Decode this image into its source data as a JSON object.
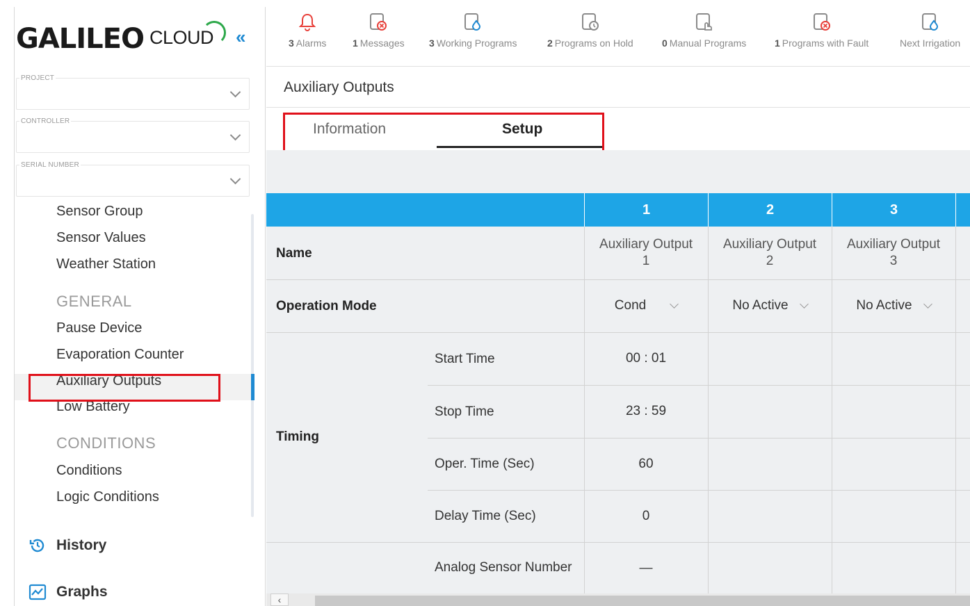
{
  "brand": {
    "logo_main": "GALILEO",
    "logo_cloud": "CLOUD",
    "collapse_glyph": "«"
  },
  "sidebar": {
    "fields": [
      {
        "label": "PROJECT",
        "value": ""
      },
      {
        "label": "CONTROLLER",
        "value": ""
      },
      {
        "label": "SERIAL NUMBER",
        "value": ""
      }
    ],
    "menu": {
      "items_top": [
        "Sensor Group",
        "Sensor Values",
        "Weather Station"
      ],
      "group_general": "GENERAL",
      "items_general": [
        "Pause Device",
        "Evaporation Counter",
        "Auxiliary Outputs",
        "Low Battery"
      ],
      "group_conditions": "CONDITIONS",
      "items_conditions": [
        "Conditions",
        "Logic Conditions"
      ],
      "active_item": "Auxiliary Outputs"
    },
    "nav": {
      "history": "History",
      "graphs": "Graphs"
    }
  },
  "topbar": {
    "stats": [
      {
        "count": "3",
        "label": "Alarms",
        "icon": "bell-icon"
      },
      {
        "count": "1",
        "label": "Messages",
        "icon": "message-fault-icon"
      },
      {
        "count": "3",
        "label": "Working Programs",
        "icon": "working-program-icon"
      },
      {
        "count": "2",
        "label": "Programs on Hold",
        "icon": "program-hold-icon"
      },
      {
        "count": "0",
        "label": "Manual Programs",
        "icon": "manual-program-icon"
      },
      {
        "count": "1",
        "label": "Programs with Fault",
        "icon": "program-fault-icon"
      },
      {
        "count": "",
        "label": "Next Irrigation",
        "icon": "next-irrigation-icon"
      }
    ]
  },
  "page": {
    "title": "Auxiliary Outputs",
    "tabs": [
      "Information",
      "Setup"
    ],
    "active_tab": "Setup"
  },
  "table": {
    "columns": [
      "1",
      "2",
      "3"
    ],
    "rows": {
      "name": {
        "label": "Name",
        "values": [
          [
            "Auxiliary Output",
            "1"
          ],
          [
            "Auxiliary Output",
            "2"
          ],
          [
            "Auxiliary Output",
            "3"
          ]
        ]
      },
      "operation_mode": {
        "label": "Operation Mode",
        "values": [
          "Cond",
          "No Active",
          "No Active"
        ]
      },
      "timing": {
        "label": "Timing",
        "sub": [
          {
            "label": "Start Time",
            "values": [
              "00 : 01",
              "",
              ""
            ]
          },
          {
            "label": "Stop Time",
            "values": [
              "23 : 59",
              "",
              ""
            ]
          },
          {
            "label": "Oper. Time (Sec)",
            "values": [
              "60",
              "",
              ""
            ]
          },
          {
            "label": "Delay Time (Sec)",
            "values": [
              "0",
              "",
              ""
            ]
          }
        ]
      },
      "analog": {
        "label": "Analog Sensor Number",
        "values": [
          "—",
          "",
          ""
        ]
      }
    }
  },
  "colors": {
    "accent": "#1ea5e6",
    "link_blue": "#1f8ad2",
    "highlight": "#e0101a",
    "alarm_red": "#e8403a",
    "brand_green": "#2da84a"
  },
  "scroll_left_glyph": "‹"
}
